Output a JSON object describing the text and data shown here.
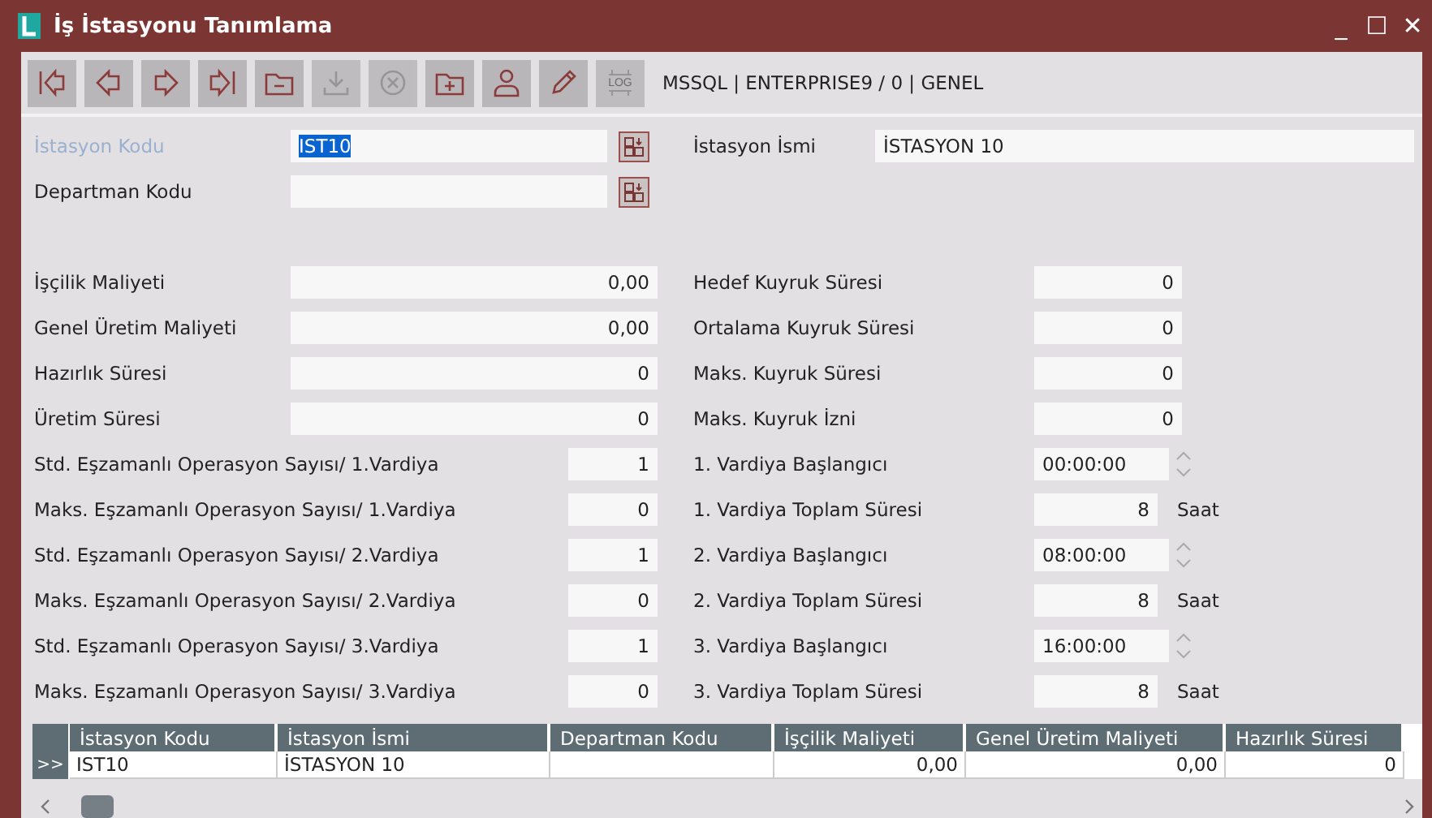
{
  "window": {
    "title": "İş İstasyonu Tanımlama",
    "controls": [
      "_",
      "☐",
      "✕"
    ]
  },
  "toolbar": {
    "buttons": [
      {
        "kind": "first",
        "disabled": false
      },
      {
        "kind": "prev",
        "disabled": false
      },
      {
        "kind": "next",
        "disabled": false
      },
      {
        "kind": "last",
        "disabled": false
      },
      {
        "kind": "folder-minus",
        "disabled": false
      },
      {
        "kind": "save",
        "disabled": true
      },
      {
        "kind": "cancel",
        "disabled": true
      },
      {
        "kind": "folder-plus",
        "disabled": false
      },
      {
        "kind": "user",
        "disabled": false
      },
      {
        "kind": "edit",
        "disabled": false
      },
      {
        "kind": "log",
        "disabled": true,
        "text": "LOG"
      }
    ],
    "connection": "MSSQL | ENTERPRISE9 / 0 | GENEL"
  },
  "header": {
    "code": {
      "label": "İstasyon Kodu",
      "value": "IST10",
      "focused": true
    },
    "name": {
      "label": "İstasyon İsmi",
      "value": "İSTASYON 10"
    },
    "department": {
      "label": "Departman Kodu",
      "focused": false
    }
  },
  "rows": [
    {
      "left": {
        "label": "İşçilik Maliyeti",
        "value": "0,00",
        "kind": "wide"
      },
      "right": {
        "label": "Hedef Kuyruk Süresi",
        "value": "0",
        "kind": "number"
      }
    },
    {
      "left": {
        "label": "Genel Üretim Maliyeti",
        "value": "0,00",
        "kind": "wide"
      },
      "right": {
        "label": "Ortalama Kuyruk Süresi",
        "value": "0",
        "kind": "number"
      }
    },
    {
      "left": {
        "label": "Hazırlık Süresi",
        "value": "0",
        "kind": "wide"
      },
      "right": {
        "label": "Maks. Kuyruk Süresi",
        "value": "0",
        "kind": "number"
      }
    },
    {
      "left": {
        "label": "Üretim Süresi",
        "value": "0",
        "kind": "wide"
      },
      "right": {
        "label": "Maks. Kuyruk İzni",
        "value": "0",
        "kind": "number"
      }
    },
    {
      "left": {
        "label": "Std. Eşzamanlı Operasyon Sayısı/ 1.Vardiya",
        "value": "1",
        "kind": "narrow"
      },
      "right": {
        "label": "1. Vardiya Başlangıcı",
        "value": "00:00:00",
        "kind": "time"
      }
    },
    {
      "left": {
        "label": "Maks. Eşzamanlı Operasyon Sayısı/ 1.Vardiya",
        "value": "0",
        "kind": "narrow"
      },
      "right": {
        "label": "1. Vardiya Toplam Süresi",
        "value": "8",
        "kind": "hours",
        "unit": "Saat"
      }
    },
    {
      "left": {
        "label": "Std. Eşzamanlı Operasyon Sayısı/ 2.Vardiya",
        "value": "1",
        "kind": "narrow"
      },
      "right": {
        "label": "2. Vardiya Başlangıcı",
        "value": "08:00:00",
        "kind": "time"
      }
    },
    {
      "left": {
        "label": "Maks. Eşzamanlı Operasyon Sayısı/ 2.Vardiya",
        "value": "0",
        "kind": "narrow"
      },
      "right": {
        "label": "2. Vardiya Toplam Süresi",
        "value": "8",
        "kind": "hours",
        "unit": "Saat"
      }
    },
    {
      "left": {
        "label": "Std. Eşzamanlı Operasyon Sayısı/ 3.Vardiya",
        "value": "1",
        "kind": "narrow"
      },
      "right": {
        "label": "3. Vardiya Başlangıcı",
        "value": "16:00:00",
        "kind": "time"
      }
    },
    {
      "left": {
        "label": "Maks. Eşzamanlı Operasyon Sayısı/ 3.Vardiya",
        "value": "0",
        "kind": "narrow"
      },
      "right": {
        "label": "3. Vardiya Toplam Süresi",
        "value": "8",
        "kind": "hours",
        "unit": "Saat"
      }
    }
  ],
  "table": {
    "columns": [
      "İstasyon Kodu",
      "İstasyon İsmi",
      "Departman Kodu",
      "İşçilik Maliyeti",
      "Genel Üretim Maliyeti",
      "Hazırlık Süresi"
    ],
    "rows": [
      {
        "indicator": ">>",
        "selected": true,
        "cells": [
          "IST10",
          "İSTASYON 10",
          "",
          "0,00",
          "0,00",
          "0"
        ]
      }
    ]
  }
}
